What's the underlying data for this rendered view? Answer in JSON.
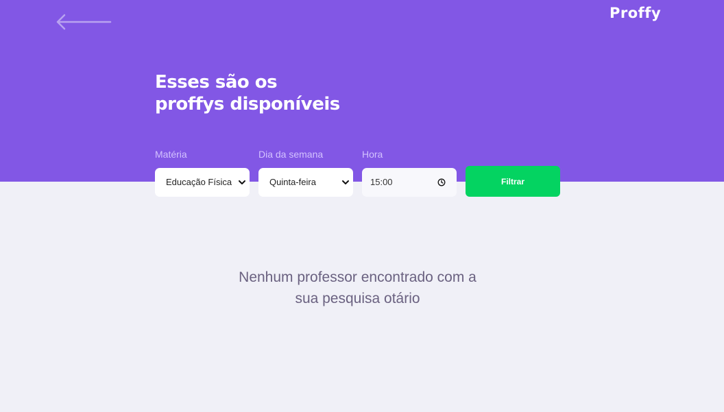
{
  "header": {
    "logo": "Proffy",
    "title_line1": "Esses são os",
    "title_line2": "proffys disponíveis"
  },
  "filters": {
    "subject": {
      "label": "Matéria",
      "value": "Educação Física"
    },
    "weekday": {
      "label": "Dia da semana",
      "value": "Quinta-feira"
    },
    "time": {
      "label": "Hora",
      "value": "15:00"
    },
    "submit_label": "Filtrar"
  },
  "results": {
    "empty_message_line1": "Nenhum professor encontrado com a",
    "empty_message_line2": "sua pesquisa otário"
  },
  "colors": {
    "primary": "#8257E5",
    "secondary": "#04D361",
    "background": "#F0F0F7",
    "label": "#D4C2FF",
    "muted_text": "#6A6180"
  },
  "icons": {
    "back": "arrow-left-icon",
    "select": "chevron-down-icon",
    "time": "clock-icon"
  }
}
